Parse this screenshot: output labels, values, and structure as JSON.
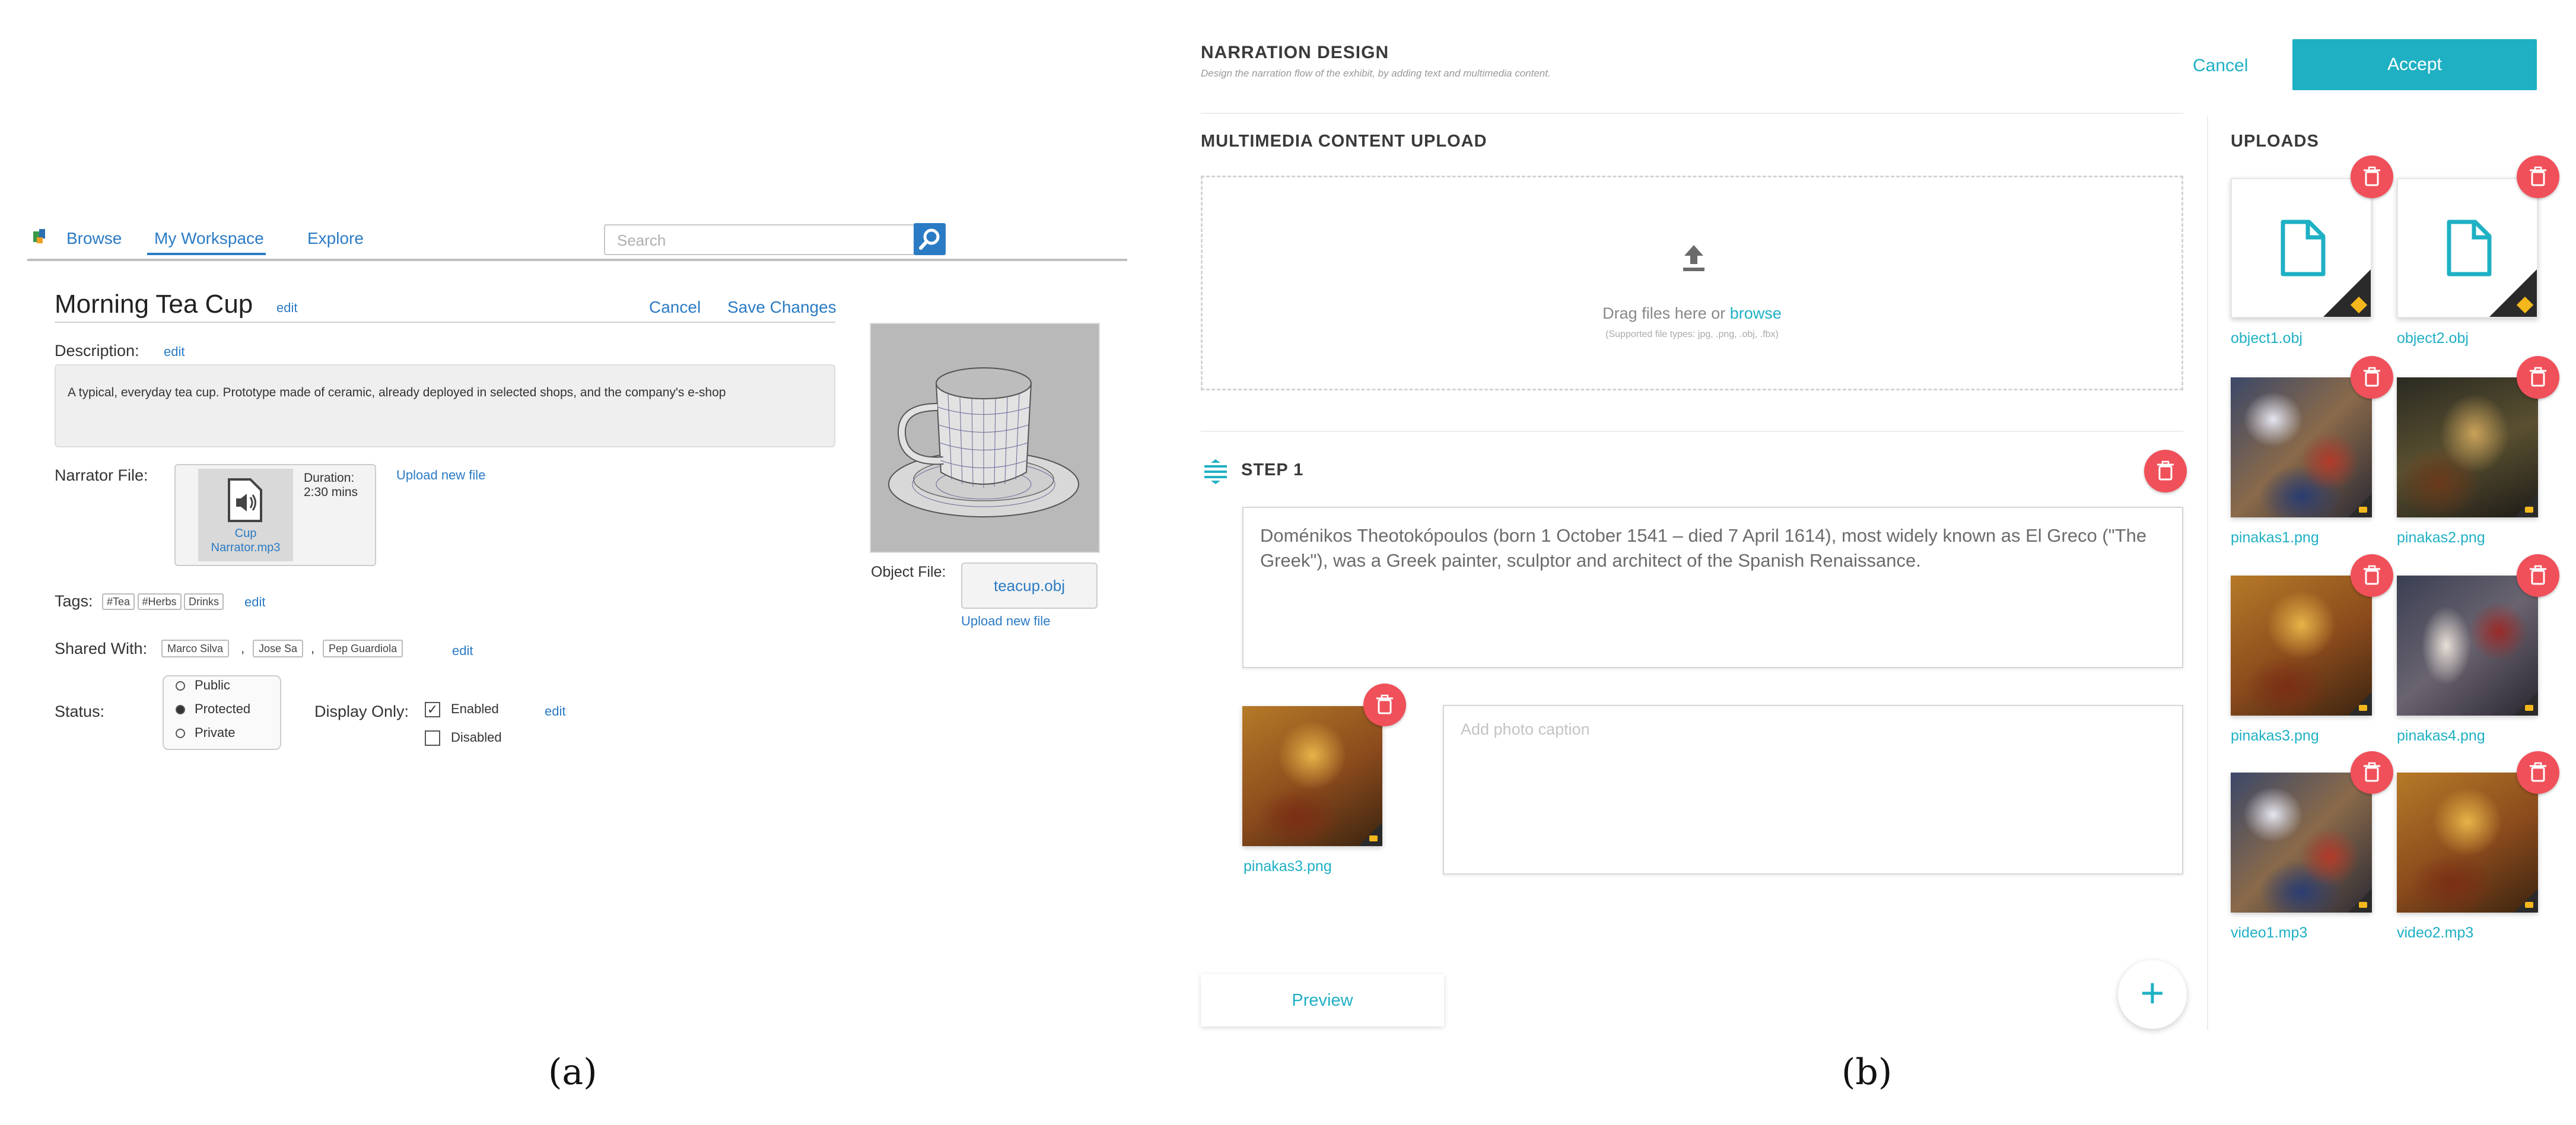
{
  "panel_a": {
    "nav": {
      "browse": "Browse",
      "workspace": "My Workspace",
      "explore": "Explore",
      "search_placeholder": "Search"
    },
    "title": "Morning Tea Cup",
    "title_edit": "edit",
    "cancel": "Cancel",
    "save": "Save Changes",
    "description_label": "Description:",
    "description_edit": "edit",
    "description_text": "A typical, everyday tea cup. Prototype made of ceramic, already deployed in selected shops, and the company's e-shop",
    "narrator_label": "Narrator File:",
    "narrator_name_1": "Cup",
    "narrator_name_2": "Narrator.mp3",
    "duration_label": "Duration:",
    "duration_value": "2:30 mins",
    "upload_new": "Upload new file",
    "tags_label": "Tags:",
    "tags": [
      "#Tea",
      "#Herbs",
      "Drinks"
    ],
    "tags_edit": "edit",
    "shared_label": "Shared With:",
    "shared": [
      "Marco Silva",
      "Jose Sa",
      "Pep Guardiola"
    ],
    "shared_edit": "edit",
    "status_label": "Status:",
    "status_options": [
      "Public",
      "Protected",
      "Private"
    ],
    "status_selected": "Protected",
    "display_label": "Display Only:",
    "display_options": [
      "Enabled",
      "Disabled"
    ],
    "display_checked": "Enabled",
    "display_edit": "edit",
    "object_label": "Object File:",
    "object_name": "teacup.obj",
    "object_upload": "Upload new file"
  },
  "panel_b": {
    "title": "NARRATION DESIGN",
    "subtitle": "Design the narration flow of the exhibit, by adding text and multimedia content.",
    "cancel": "Cancel",
    "accept": "Accept",
    "upload_heading": "MULTIMEDIA CONTENT UPLOAD",
    "drop_text": "Drag files here or",
    "drop_link": "browse",
    "drop_types": "(Supported file types: jpg, .png, .obj, .fbx)",
    "step_title": "STEP 1",
    "step_text": "Doménikos Theotokópoulos (born 1 October 1541 – died 7 April 1614), most widely known as El Greco (\"The Greek\"), was a Greek painter, sculptor and architect of the Spanish Renaissance.",
    "step_image_name": "pinakas3.png",
    "caption_placeholder": "Add photo caption",
    "preview": "Preview",
    "add_symbol": "+",
    "uploads_heading": "UPLOADS",
    "uploads": [
      {
        "name": "object1.obj",
        "kind": "object-file"
      },
      {
        "name": "object2.obj",
        "kind": "object-file"
      },
      {
        "name": "pinakas1.png",
        "kind": "image"
      },
      {
        "name": "pinakas2.png",
        "kind": "image"
      },
      {
        "name": "pinakas3.png",
        "kind": "image"
      },
      {
        "name": "pinakas4.png",
        "kind": "image"
      },
      {
        "name": "video1.mp3",
        "kind": "video"
      },
      {
        "name": "video2.mp3",
        "kind": "video"
      }
    ],
    "colors": {
      "accent": "#1fb0c4",
      "delete": "#f0505a"
    }
  },
  "captions": {
    "a": "(a)",
    "b": "(b)"
  }
}
